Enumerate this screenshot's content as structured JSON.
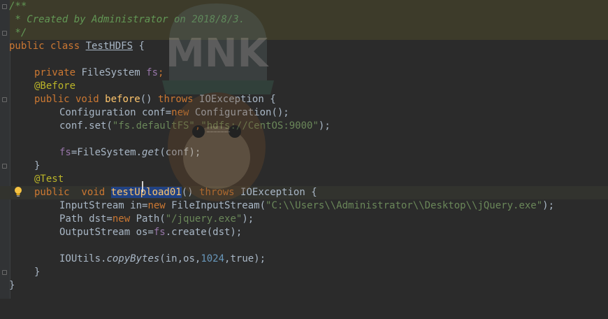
{
  "editor": {
    "doc_comment": [
      "/**",
      " * Created by Administrator on 2018/8/3.",
      " */"
    ],
    "class_decl": {
      "kw": "public class ",
      "name": "TestHDFS",
      "rest": " {"
    },
    "field": {
      "kw": "private ",
      "type": "FileSystem ",
      "name": "fs",
      "semi": ";"
    },
    "annotation_before": "@Before",
    "before_method": {
      "kw1": "public void ",
      "name": "before",
      "parens": "() ",
      "throws": "throws ",
      "exc": "IOException {"
    },
    "conf_line": {
      "a": "Configuration conf=",
      "new": "new ",
      "b": "Configuration();"
    },
    "set_line": {
      "a": "conf.set(",
      "s1": "\"fs.defaultFS\"",
      "comma": ",",
      "s2a": "\"",
      "s2b": "hdfs",
      "s2c": "://CentOS:9000\"",
      "end": ");"
    },
    "fs_line": {
      "fs": "fs",
      "a": "=FileSystem.",
      "get": "get",
      "b": "(conf);"
    },
    "close1": "}",
    "annotation_test": "@Test",
    "test_method": {
      "kw1": "public  void ",
      "name": "testUpload01",
      "parens": "() ",
      "throws": "throws ",
      "exc": "IOException {"
    },
    "in_line": {
      "a": "InputStream in=",
      "new": "new ",
      "b": "FileInputStream(",
      "s": "\"C:\\\\Users\\\\Administrator\\\\Desktop\\\\jQuery.exe\"",
      "end": ");"
    },
    "path_line": {
      "a": "Path dst=",
      "new": "new ",
      "b": "Path(",
      "s": "\"/jquery.exe\"",
      "end": ");"
    },
    "out_line": {
      "a": "OutputStream os=",
      "fs": "fs",
      "b": ".create(dst);"
    },
    "copy_line": {
      "a": "IOUtils.",
      "m": "copyBytes",
      "b": "(in,os,",
      "n": "1024",
      "c": ",true);"
    },
    "close2": "}",
    "close3": "}"
  },
  "watermark": {
    "text": "MNK"
  },
  "colors": {
    "background": "#2b2b2b",
    "keyword": "#cc7832",
    "string": "#6a8759",
    "annotation": "#bbb529",
    "field": "#9876aa",
    "number": "#6897bb",
    "selection": "#214283"
  }
}
